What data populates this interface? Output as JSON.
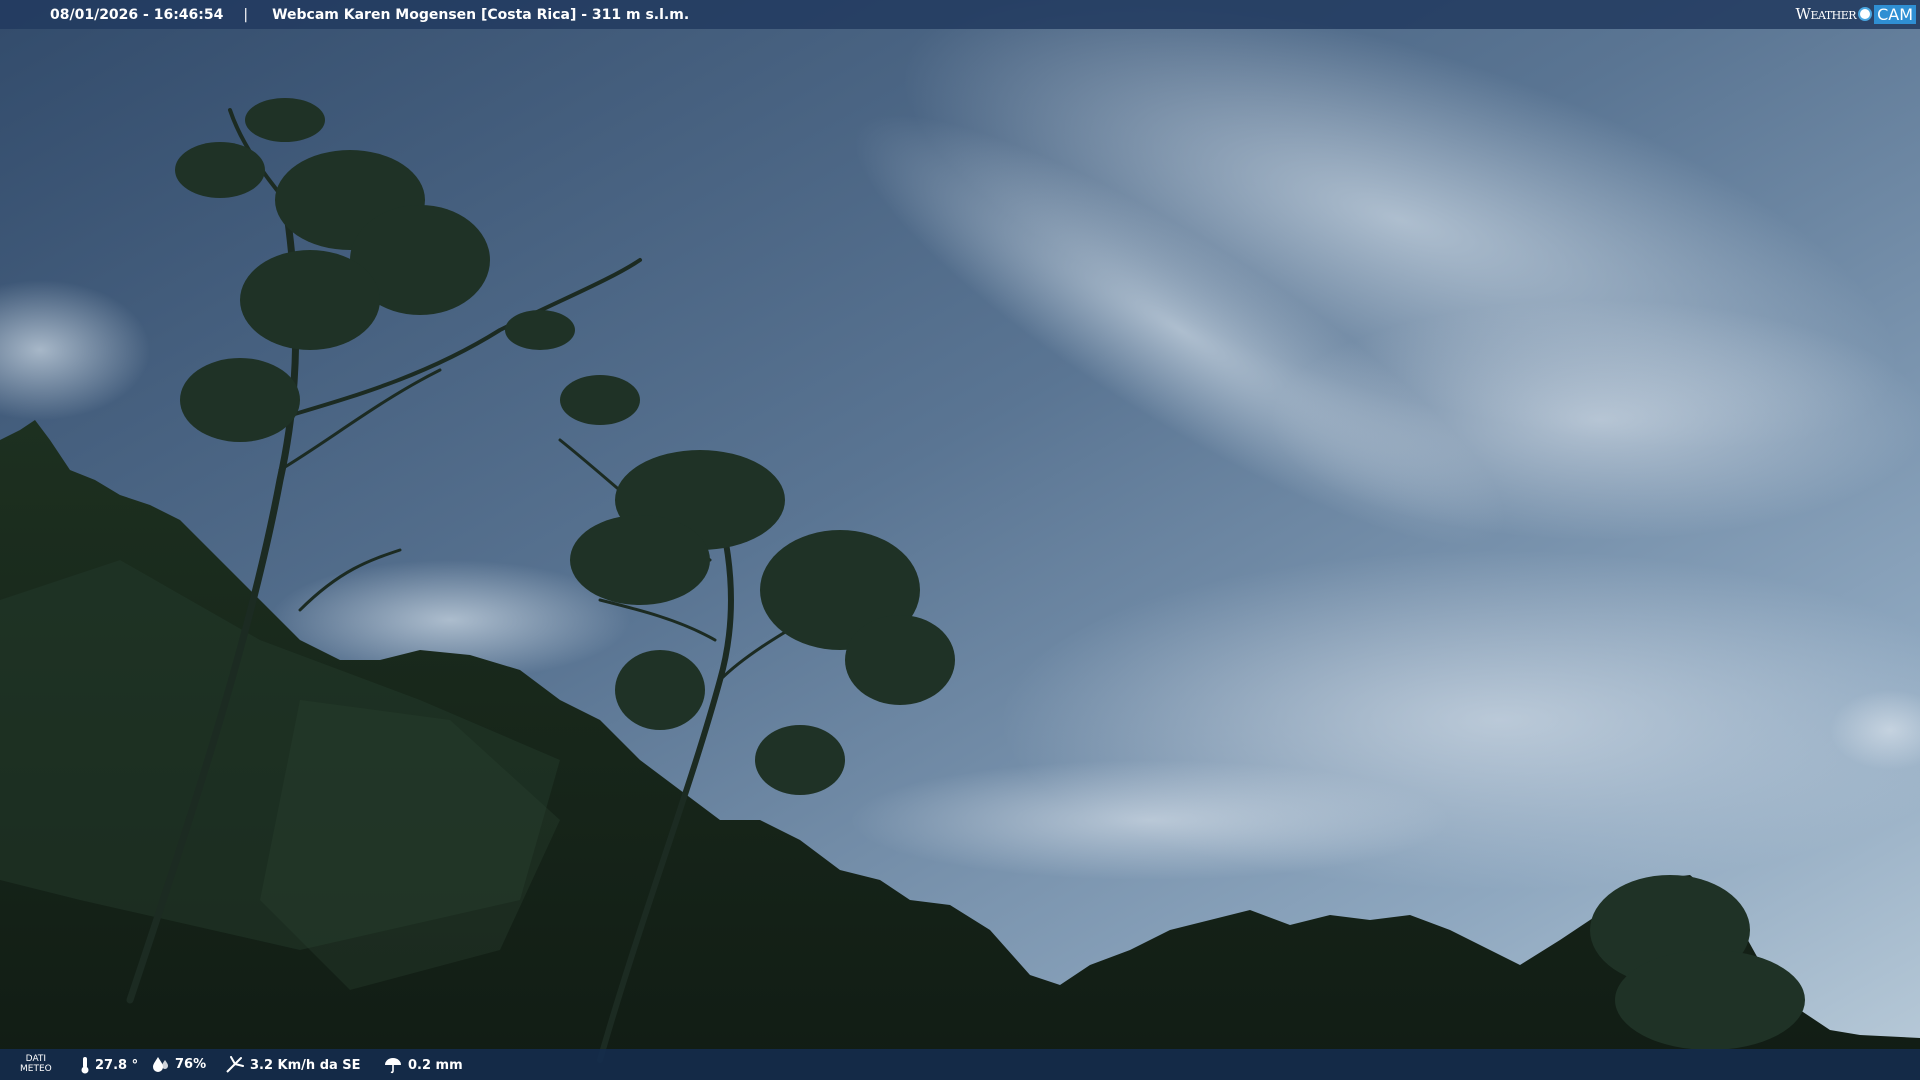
{
  "overlay_top": {
    "timestamp": "08/01/2026 - 16:46:54",
    "separator": "|",
    "title": "Webcam Karen Mogensen [Costa Rica] - 311 m s.l.m."
  },
  "logo": {
    "weather": "Weather",
    "cam": "CAM"
  },
  "overlay_bottom": {
    "dati_label_1": "DATI",
    "dati_label_2": "METEO",
    "temperature": "27.8 °",
    "humidity": "76%",
    "wind": "3.2 Km/h da SE",
    "rain": "0.2 mm"
  },
  "icons": [
    "thermometer-icon",
    "humidity-drop-icon",
    "wind-icon",
    "rain-umbrella-icon"
  ],
  "colors": {
    "bar": "#223a5f",
    "sky_top": "#3a5473",
    "sky_bottom": "#a7bdd0",
    "vegetation": "#1a2c1e"
  }
}
